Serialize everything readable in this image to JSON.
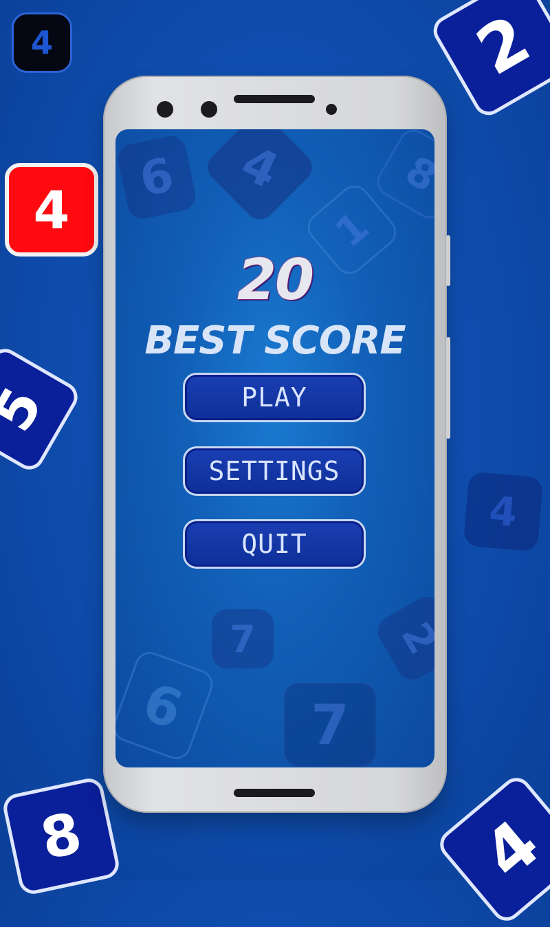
{
  "background_tiles": [
    {
      "value": "4",
      "style": "black"
    },
    {
      "value": "2",
      "style": "navy"
    },
    {
      "value": "4",
      "style": "red"
    },
    {
      "value": "5",
      "style": "navy"
    },
    {
      "value": "4",
      "style": "faded"
    },
    {
      "value": "8",
      "style": "navy"
    },
    {
      "value": "4",
      "style": "navy"
    }
  ],
  "screen_tiles": [
    "6",
    "4",
    "8",
    "1",
    "7",
    "2",
    "6",
    "7"
  ],
  "game": {
    "best_score_value": "20",
    "best_score_label": "BEST SCORE"
  },
  "menu": {
    "play_label": "PLAY",
    "settings_label": "SETTINGS",
    "quit_label": "QUIT"
  },
  "colors": {
    "background": "#0f4fb0",
    "tile_navy": "#0a1f9a",
    "tile_red": "#ff0a10",
    "button_fill": "#0e2f98"
  }
}
